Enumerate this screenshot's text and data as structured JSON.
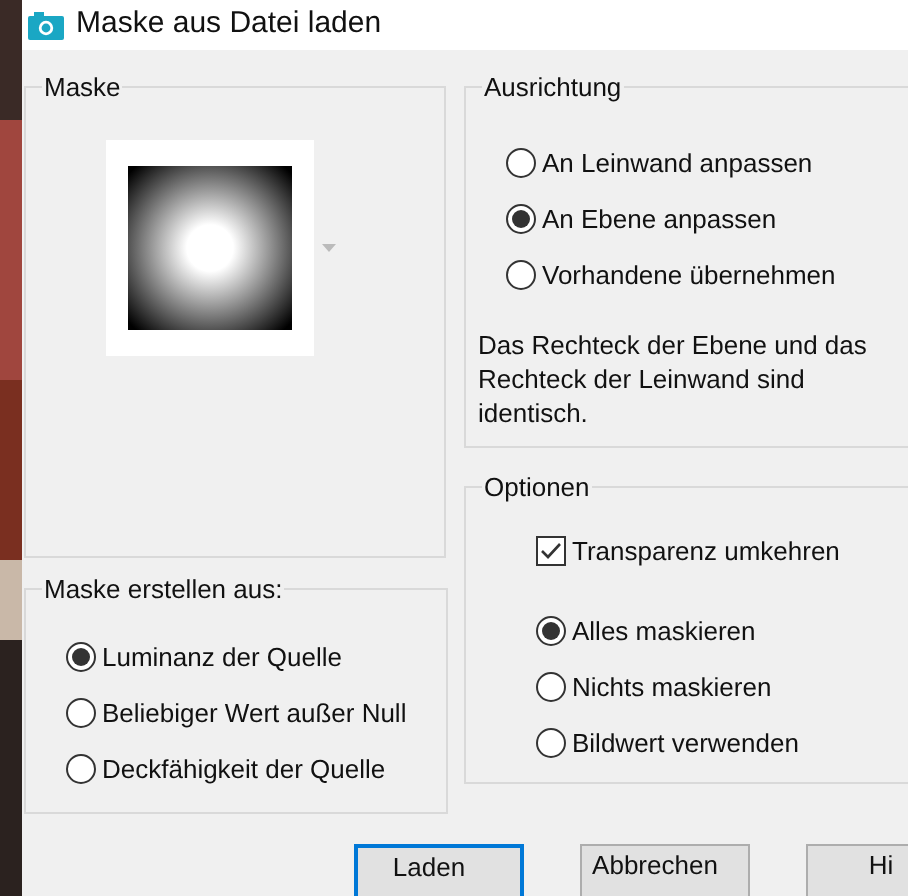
{
  "window": {
    "title": "Maske aus Datei laden"
  },
  "mask": {
    "title": "Maske"
  },
  "source": {
    "title": "Maske erstellen aus:",
    "options": [
      {
        "label": "Luminanz der Quelle",
        "selected": true
      },
      {
        "label": "Beliebiger Wert außer Null",
        "selected": false
      },
      {
        "label": "Deckfähigkeit der Quelle",
        "selected": false
      }
    ]
  },
  "orientation": {
    "title": "Ausrichtung",
    "options": [
      {
        "label": "An Leinwand anpassen",
        "selected": false
      },
      {
        "label": "An Ebene anpassen",
        "selected": true
      },
      {
        "label": "Vorhandene übernehmen",
        "selected": false
      }
    ],
    "note": "Das Rechteck der Ebene und das Rechteck der Leinwand sind identisch."
  },
  "options": {
    "title": "Optionen",
    "invert": {
      "label": "Transparenz umkehren",
      "checked": true
    },
    "modes": [
      {
        "label": "Alles maskieren",
        "selected": true
      },
      {
        "label": "Nichts maskieren",
        "selected": false
      },
      {
        "label": "Bildwert verwenden",
        "selected": false
      }
    ]
  },
  "buttons": [
    {
      "label": "Laden",
      "default": true
    },
    {
      "label": "Abbrechen",
      "default": false
    },
    {
      "label": "Hi",
      "default": false
    }
  ]
}
